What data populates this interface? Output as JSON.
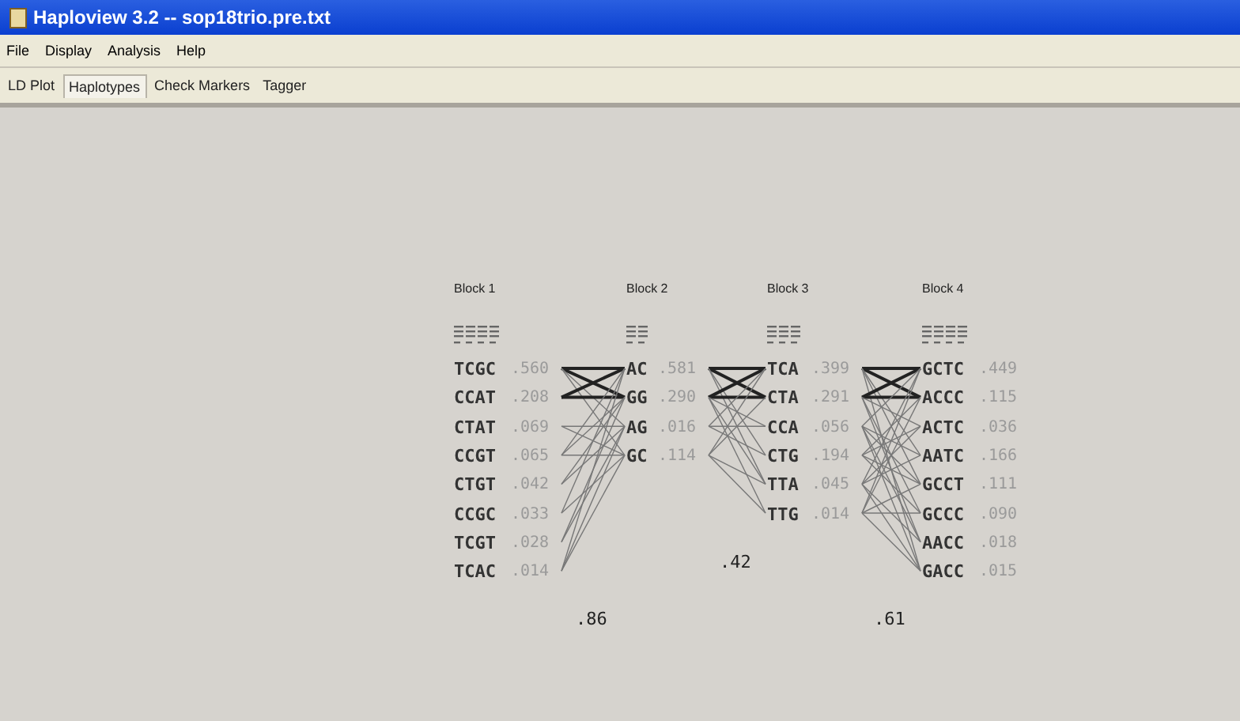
{
  "window": {
    "title": "Haploview 3.2 -- sop18trio.pre.txt"
  },
  "menu": [
    "File",
    "Display",
    "Analysis",
    "Help"
  ],
  "tabs": [
    {
      "label": "LD Plot",
      "selected": false
    },
    {
      "label": "Haplotypes",
      "selected": true
    },
    {
      "label": "Check Markers",
      "selected": false
    },
    {
      "label": "Tagger",
      "selected": false
    }
  ],
  "blocks": [
    {
      "title": "Block 1",
      "haplotypes": [
        {
          "alleles": "TCGC",
          "freq": ".560"
        },
        {
          "alleles": "CCAT",
          "freq": ".208"
        },
        {
          "alleles": "CTAT",
          "freq": ".069"
        },
        {
          "alleles": "CCGT",
          "freq": ".065"
        },
        {
          "alleles": "CTGT",
          "freq": ".042"
        },
        {
          "alleles": "CCGC",
          "freq": ".033"
        },
        {
          "alleles": "TCGT",
          "freq": ".028"
        },
        {
          "alleles": "TCAC",
          "freq": ".014"
        }
      ],
      "multilocus_d": ".86"
    },
    {
      "title": "Block 2",
      "haplotypes": [
        {
          "alleles": "AC",
          "freq": ".581"
        },
        {
          "alleles": "GG",
          "freq": ".290"
        },
        {
          "alleles": "AG",
          "freq": ".016"
        },
        {
          "alleles": "GC",
          "freq": ".114"
        }
      ],
      "multilocus_d": ".42"
    },
    {
      "title": "Block 3",
      "haplotypes": [
        {
          "alleles": "TCA",
          "freq": ".399"
        },
        {
          "alleles": "CTA",
          "freq": ".291"
        },
        {
          "alleles": "CCA",
          "freq": ".056"
        },
        {
          "alleles": "CTG",
          "freq": ".194"
        },
        {
          "alleles": "TTA",
          "freq": ".045"
        },
        {
          "alleles": "TTG",
          "freq": ".014"
        }
      ],
      "multilocus_d": ".61"
    },
    {
      "title": "Block 4",
      "haplotypes": [
        {
          "alleles": "GCTC",
          "freq": ".449"
        },
        {
          "alleles": "ACCC",
          "freq": ".115"
        },
        {
          "alleles": "ACTC",
          "freq": ".036"
        },
        {
          "alleles": "AATC",
          "freq": ".166"
        },
        {
          "alleles": "GCCT",
          "freq": ".111"
        },
        {
          "alleles": "GCCC",
          "freq": ".090"
        },
        {
          "alleles": "AACC",
          "freq": ".018"
        },
        {
          "alleles": "GACC",
          "freq": ".015"
        }
      ]
    }
  ]
}
